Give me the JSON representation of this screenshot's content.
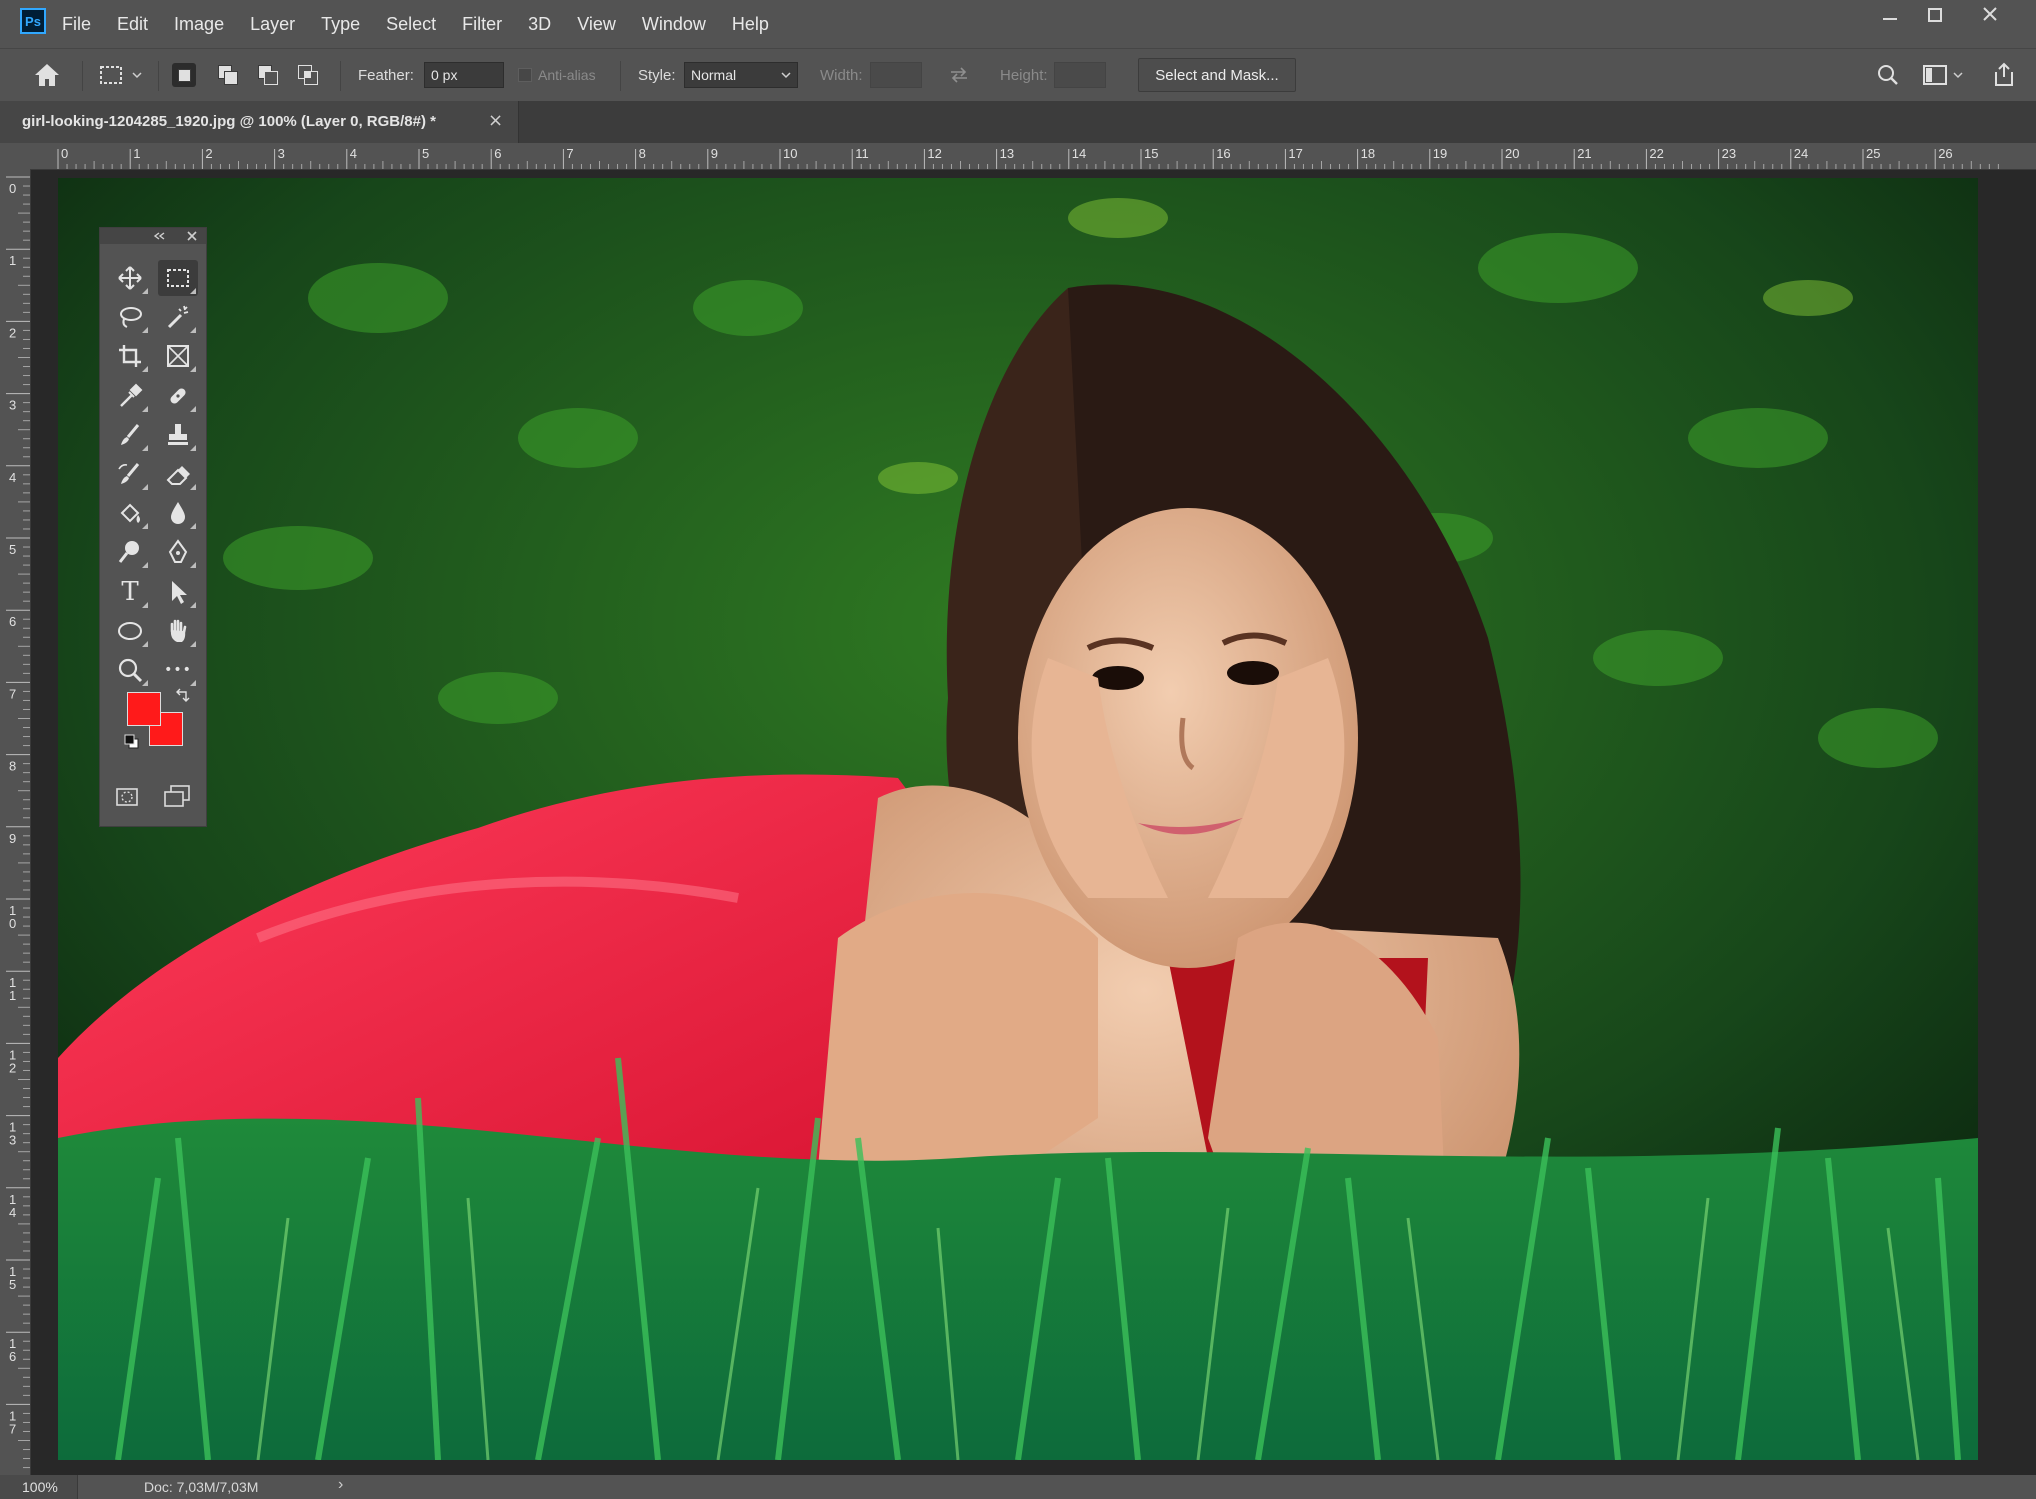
{
  "app": {
    "logo": "Ps"
  },
  "menu": [
    "File",
    "Edit",
    "Image",
    "Layer",
    "Type",
    "Select",
    "Filter",
    "3D",
    "View",
    "Window",
    "Help"
  ],
  "options": {
    "feather_label": "Feather:",
    "feather_value": "0 px",
    "antialias_label": "Anti-alias",
    "style_label": "Style:",
    "style_value": "Normal",
    "width_label": "Width:",
    "height_label": "Height:",
    "select_mask_button": "Select and Mask..."
  },
  "document": {
    "tab_title": "girl-looking-1204285_1920.jpg @ 100% (Layer 0, RGB/8#) *",
    "close": "×"
  },
  "rulers": {
    "horizontal": [
      "0",
      "1",
      "2",
      "3",
      "4",
      "5",
      "6",
      "7",
      "8",
      "9",
      "10",
      "11",
      "12",
      "13",
      "14",
      "15",
      "16",
      "17",
      "18",
      "19",
      "20",
      "21",
      "22",
      "23",
      "24",
      "25",
      "26"
    ],
    "vertical": [
      "0",
      "1",
      "2",
      "3",
      "4",
      "5",
      "6",
      "7",
      "8",
      "9",
      "10",
      "11",
      "12",
      "13",
      "14",
      "15",
      "16",
      "17"
    ]
  },
  "colors": {
    "foreground": "#ff1a1a",
    "background": "#ff1a1a",
    "accent": "#31a8ff"
  },
  "toolbar": {
    "tools": [
      [
        "move-icon",
        "rect-marquee-icon"
      ],
      [
        "lasso-icon",
        "magic-wand-icon"
      ],
      [
        "crop-icon",
        "frame-icon"
      ],
      [
        "eyedropper-icon",
        "healing-brush-icon"
      ],
      [
        "brush-icon",
        "clone-stamp-icon"
      ],
      [
        "history-brush-icon",
        "eraser-icon"
      ],
      [
        "paint-bucket-icon",
        "blur-icon"
      ],
      [
        "dodge-icon",
        "pen-icon"
      ],
      [
        "type-icon",
        "path-selection-icon"
      ],
      [
        "ellipse-icon",
        "hand-icon"
      ],
      [
        "zoom-icon",
        "more-tools-icon"
      ]
    ],
    "type_glyph": "T",
    "more_glyph": "•••"
  },
  "status": {
    "zoom": "100%",
    "doc_size": "Doc: 7,03M/7,03M",
    "arrow": "›"
  }
}
